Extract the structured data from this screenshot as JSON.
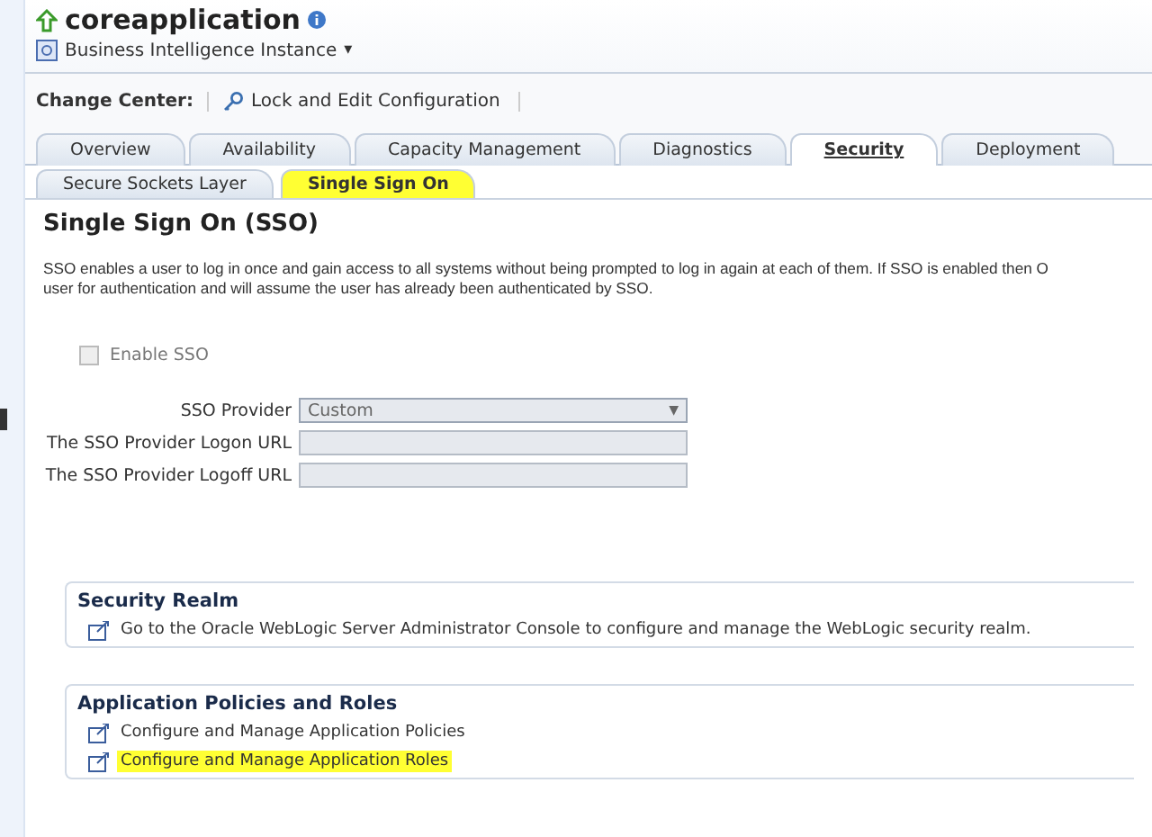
{
  "header": {
    "title": "coreapplication",
    "subtitle": "Business Intelligence Instance",
    "subtitle_caret": "▾"
  },
  "change_center": {
    "label": "Change Center:",
    "action": "Lock and Edit Configuration"
  },
  "tabs": [
    {
      "label": "Overview",
      "selected": false
    },
    {
      "label": "Availability",
      "selected": false
    },
    {
      "label": "Capacity Management",
      "selected": false
    },
    {
      "label": "Diagnostics",
      "selected": false
    },
    {
      "label": "Security",
      "selected": true
    },
    {
      "label": "Deployment",
      "selected": false
    }
  ],
  "subtabs": [
    {
      "label": "Secure Sockets Layer",
      "selected": false,
      "highlighted": false
    },
    {
      "label": "Single Sign On",
      "selected": true,
      "highlighted": true
    }
  ],
  "section": {
    "title": "Single Sign On (SSO)",
    "description_lines": [
      "SSO enables a user to log in once and gain access to all systems without being prompted to log in again at each of them. If SSO is enabled then O",
      "user for authentication and will assume the user has already been authenticated by SSO."
    ]
  },
  "enable_sso": {
    "label": "Enable SSO",
    "checked": false,
    "disabled": true
  },
  "fields": [
    {
      "kind": "select",
      "label": "SSO Provider",
      "value": "Custom",
      "caret": "▼"
    },
    {
      "kind": "text",
      "label": "The SSO Provider Logon URL"
    },
    {
      "kind": "text",
      "label": "The SSO Provider Logoff URL"
    }
  ],
  "panels": [
    {
      "title": "Security Realm",
      "links": [
        {
          "label": "Go to the Oracle WebLogic Server Administrator Console to configure and manage the WebLogic security realm.",
          "highlighted": false
        }
      ]
    },
    {
      "title": "Application Policies and Roles",
      "links": [
        {
          "label": "Configure and Manage Application Policies",
          "highlighted": false
        },
        {
          "label": "Configure and Manage Application Roles",
          "highlighted": true
        }
      ]
    }
  ]
}
